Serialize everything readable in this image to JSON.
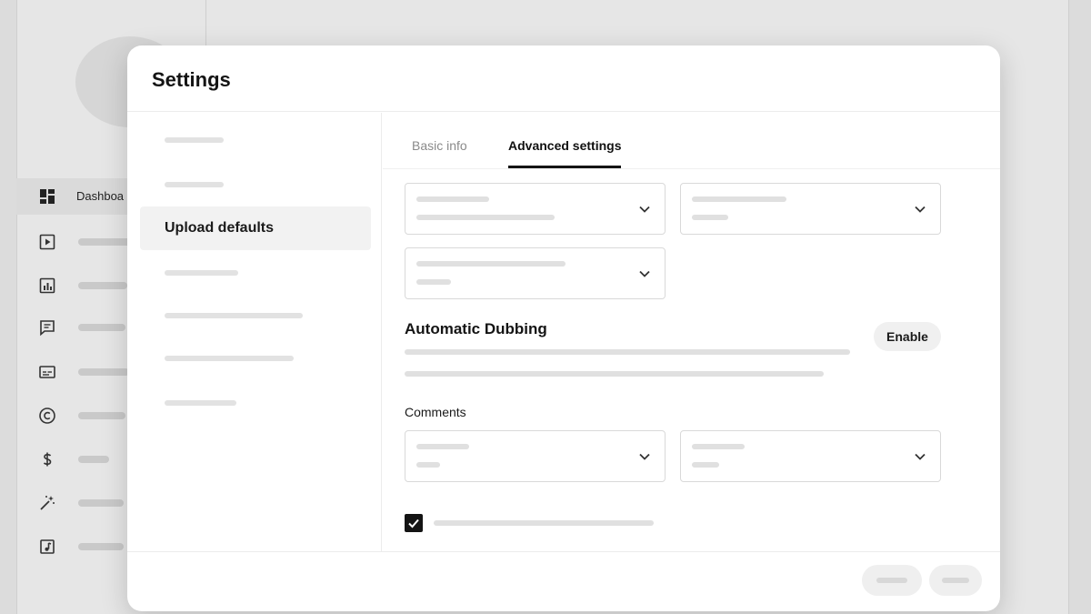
{
  "app": {
    "nav": [
      {
        "label": "Dashboa",
        "icon": "dashboard-icon"
      },
      {
        "label": "",
        "icon": "content-icon"
      },
      {
        "label": "",
        "icon": "analytics-icon"
      },
      {
        "label": "",
        "icon": "comments-icon"
      },
      {
        "label": "",
        "icon": "subtitles-icon"
      },
      {
        "label": "",
        "icon": "copyright-icon"
      },
      {
        "label": "",
        "icon": "earn-icon"
      },
      {
        "label": "",
        "icon": "customization-icon"
      },
      {
        "label": "",
        "icon": "audio-library-icon"
      }
    ]
  },
  "dialog": {
    "title": "Settings",
    "left_nav": {
      "active_label": "Upload defaults"
    },
    "tabs": [
      {
        "label": "Basic info",
        "active": false
      },
      {
        "label": "Advanced settings",
        "active": true
      }
    ],
    "dubbing": {
      "title": "Automatic Dubbing",
      "enable_label": "Enable"
    },
    "comments": {
      "label": "Comments"
    },
    "checkbox": {
      "checked": true
    }
  },
  "colors": {
    "accent": "#141414",
    "background": "#dcdcdc",
    "dialog": "#ffffff"
  }
}
